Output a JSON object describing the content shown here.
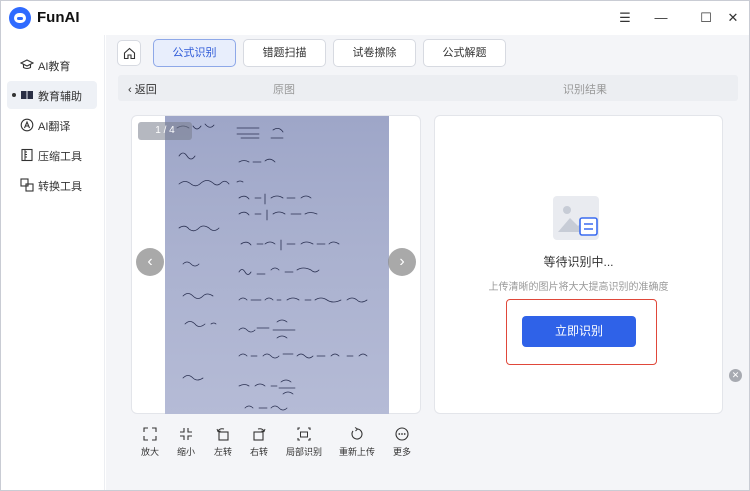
{
  "app": {
    "title": "FunAI"
  },
  "window_controls": {
    "menu": "☰",
    "minimize": "—",
    "maximize": "☐",
    "close": "✕"
  },
  "sidebar": {
    "items": [
      {
        "label": "AI教育",
        "icon": "graduation-cap-icon",
        "glyph": "🎓",
        "active": false
      },
      {
        "label": "教育辅助",
        "icon": "book-icon",
        "glyph": "▮▮",
        "active": true
      },
      {
        "label": "AI翻译",
        "icon": "translate-icon",
        "glyph": "Ⓐ",
        "active": false
      },
      {
        "label": "压缩工具",
        "icon": "compress-icon",
        "glyph": "▤",
        "active": false
      },
      {
        "label": "转换工具",
        "icon": "convert-icon",
        "glyph": "⇆",
        "active": false
      }
    ]
  },
  "tabs": [
    {
      "label": "公式识别",
      "active": true
    },
    {
      "label": "错题扫描",
      "active": false
    },
    {
      "label": "试卷擦除",
      "active": false
    },
    {
      "label": "公式解题",
      "active": false
    }
  ],
  "subbar": {
    "back_label": "返回",
    "left_title": "原图",
    "right_title": "识别结果"
  },
  "image_viewer": {
    "counter": "1 / 4",
    "prev": "‹",
    "next": "›"
  },
  "toolbar": [
    {
      "label": "放大",
      "icon": "zoom-in-icon"
    },
    {
      "label": "缩小",
      "icon": "zoom-out-icon"
    },
    {
      "label": "左转",
      "icon": "rotate-left-icon"
    },
    {
      "label": "右转",
      "icon": "rotate-right-icon"
    },
    {
      "label": "局部识别",
      "icon": "crop-icon"
    },
    {
      "label": "重新上传",
      "icon": "reupload-icon"
    },
    {
      "label": "更多",
      "icon": "more-icon"
    }
  ],
  "result": {
    "status": "等待识别中...",
    "hint": "上传清晰的图片将大大提高识别的准确度",
    "button": "立即识别"
  },
  "colors": {
    "accent": "#2f62e8",
    "highlight": "#e0483a"
  }
}
